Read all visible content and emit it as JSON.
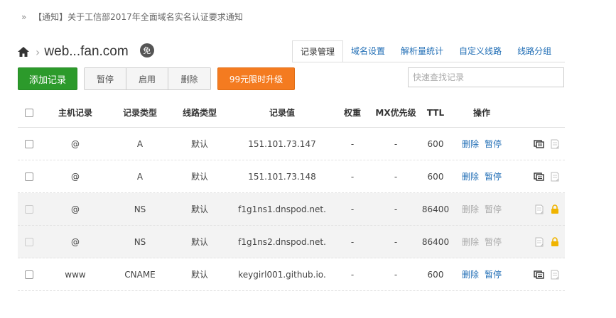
{
  "notice": {
    "bullet": "»",
    "text": "【通知】关于工信部2017年全面域名实名认证要求通知"
  },
  "domain": {
    "name": "web...fan.com",
    "badge": "免"
  },
  "tabs": [
    {
      "label": "记录管理",
      "active": true
    },
    {
      "label": "域名设置",
      "active": false
    },
    {
      "label": "解析量统计",
      "active": false
    },
    {
      "label": "自定义线路",
      "active": false
    },
    {
      "label": "线路分组",
      "active": false
    }
  ],
  "toolbar": {
    "add_label": "添加记录",
    "pause_label": "暂停",
    "enable_label": "启用",
    "delete_label": "删除",
    "upgrade_label": "99元限时升级"
  },
  "search": {
    "placeholder": "快速查找记录",
    "value": ""
  },
  "colors": {
    "add": "#2c9a2b",
    "upgrade": "#f47b20",
    "link": "#1f6db5",
    "lock": "#f0b400"
  },
  "table": {
    "headers": {
      "host": "主机记录",
      "type": "记录类型",
      "line": "线路类型",
      "value": "记录值",
      "weight": "权重",
      "mx": "MX优先级",
      "ttl": "TTL",
      "ops": "操作"
    },
    "rows": [
      {
        "host": "@",
        "type": "A",
        "line": "默认",
        "value": "151.101.73.147",
        "weight": "-",
        "mx": "-",
        "ttl": "600",
        "del": "删除",
        "pause": "暂停",
        "locked": false,
        "icons": [
          "remark-icon",
          "note-icon"
        ]
      },
      {
        "host": "@",
        "type": "A",
        "line": "默认",
        "value": "151.101.73.148",
        "weight": "-",
        "mx": "-",
        "ttl": "600",
        "del": "删除",
        "pause": "暂停",
        "locked": false,
        "icons": [
          "remark-icon",
          "note-icon"
        ]
      },
      {
        "host": "@",
        "type": "NS",
        "line": "默认",
        "value": "f1g1ns1.dnspod.net.",
        "weight": "-",
        "mx": "-",
        "ttl": "86400",
        "del": "删除",
        "pause": "暂停",
        "locked": true,
        "icons": [
          "note-icon",
          "lock-icon"
        ]
      },
      {
        "host": "@",
        "type": "NS",
        "line": "默认",
        "value": "f1g1ns2.dnspod.net.",
        "weight": "-",
        "mx": "-",
        "ttl": "86400",
        "del": "删除",
        "pause": "暂停",
        "locked": true,
        "icons": [
          "note-icon",
          "lock-icon"
        ]
      },
      {
        "host": "www",
        "type": "CNAME",
        "line": "默认",
        "value": "keygirl001.github.io.",
        "weight": "-",
        "mx": "-",
        "ttl": "600",
        "del": "删除",
        "pause": "暂停",
        "locked": false,
        "icons": [
          "remark-icon",
          "note-icon"
        ]
      }
    ]
  }
}
